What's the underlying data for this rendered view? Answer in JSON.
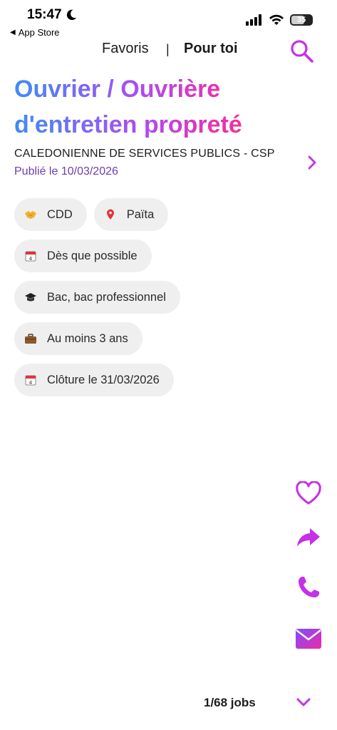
{
  "status_bar": {
    "time": "15:47",
    "back_app": "App Store",
    "battery": "35"
  },
  "nav": {
    "tabs": [
      {
        "label": "Favoris",
        "active": false
      },
      {
        "label": "Pour toi",
        "active": true
      }
    ],
    "separator": "|"
  },
  "job": {
    "title_line1": "Ouvrier / Ouvrière",
    "title_line2": "d'entretien propreté",
    "company": "CALEDONIENNE DE SERVICES PUBLICS - CSP",
    "published": "Publié le 10/03/2026",
    "tags": [
      {
        "icon": "handshake-icon",
        "label": "CDD"
      },
      {
        "icon": "location-pin-icon",
        "label": "Païta"
      },
      {
        "icon": "calendar-icon",
        "label": "Dès que possible"
      },
      {
        "icon": "graduation-cap-icon",
        "label": "Bac, bac professionnel"
      },
      {
        "icon": "briefcase-icon",
        "label": "Au moins 3 ans"
      },
      {
        "icon": "calendar-icon",
        "label": "Clôture le 31/03/2026"
      }
    ]
  },
  "footer": {
    "count": "1/68 jobs"
  },
  "colors": {
    "accent": "#cc33e6",
    "gradient_start": "#3d8df6",
    "gradient_end": "#f0496e",
    "published_text": "#6a3fb0",
    "chip_bg": "#efefef"
  }
}
